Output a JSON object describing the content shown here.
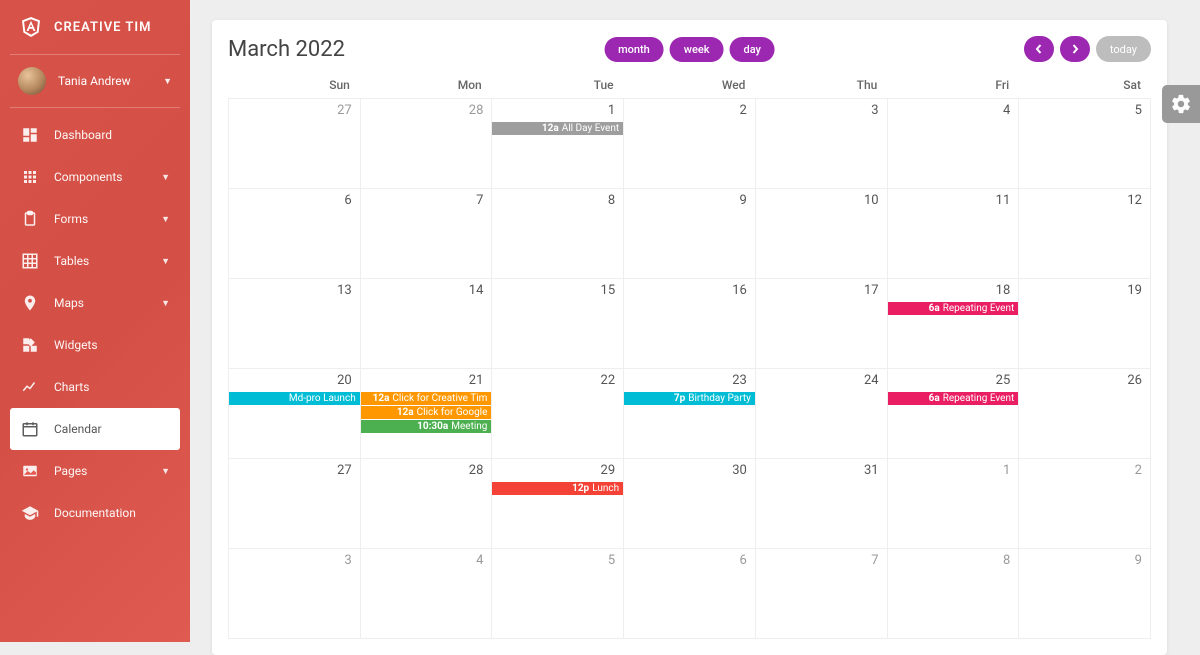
{
  "brand": {
    "title": "CREATIVE TIM"
  },
  "user": {
    "name": "Tania Andrew"
  },
  "sidebar": {
    "items": [
      {
        "label": "Dashboard",
        "icon": "dashboard",
        "caret": false
      },
      {
        "label": "Components",
        "icon": "apps",
        "caret": true
      },
      {
        "label": "Forms",
        "icon": "clipboard",
        "caret": true
      },
      {
        "label": "Tables",
        "icon": "grid",
        "caret": true
      },
      {
        "label": "Maps",
        "icon": "pin",
        "caret": true
      },
      {
        "label": "Widgets",
        "icon": "widgets",
        "caret": false
      },
      {
        "label": "Charts",
        "icon": "chart",
        "caret": false
      },
      {
        "label": "Calendar",
        "icon": "calendar",
        "caret": false,
        "active": true
      },
      {
        "label": "Pages",
        "icon": "image",
        "caret": true
      },
      {
        "label": "Documentation",
        "icon": "school",
        "caret": false
      }
    ]
  },
  "calendar": {
    "title": "March 2022",
    "views": {
      "month": "month",
      "week": "week",
      "day": "day"
    },
    "today": "today",
    "days": [
      "Sun",
      "Mon",
      "Tue",
      "Wed",
      "Thu",
      "Fri",
      "Sat"
    ],
    "cells": [
      {
        "n": "27",
        "in": false
      },
      {
        "n": "28",
        "in": false
      },
      {
        "n": "1",
        "in": true,
        "events": [
          {
            "t": "12a",
            "txt": "All Day Event",
            "c": "#9e9e9e"
          }
        ]
      },
      {
        "n": "2",
        "in": true
      },
      {
        "n": "3",
        "in": true
      },
      {
        "n": "4",
        "in": true
      },
      {
        "n": "5",
        "in": true
      },
      {
        "n": "6",
        "in": true
      },
      {
        "n": "7",
        "in": true
      },
      {
        "n": "8",
        "in": true
      },
      {
        "n": "9",
        "in": true
      },
      {
        "n": "10",
        "in": true
      },
      {
        "n": "11",
        "in": true
      },
      {
        "n": "12",
        "in": true
      },
      {
        "n": "13",
        "in": true
      },
      {
        "n": "14",
        "in": true
      },
      {
        "n": "15",
        "in": true
      },
      {
        "n": "16",
        "in": true
      },
      {
        "n": "17",
        "in": true
      },
      {
        "n": "18",
        "in": true,
        "events": [
          {
            "t": "6a",
            "txt": "Repeating Event",
            "c": "#e91e63"
          }
        ]
      },
      {
        "n": "19",
        "in": true
      },
      {
        "n": "20",
        "in": true,
        "events": [
          {
            "t": "",
            "txt": "Md-pro Launch",
            "c": "#00bcd4"
          }
        ]
      },
      {
        "n": "21",
        "in": true,
        "events": [
          {
            "t": "12a",
            "txt": "Click for Creative Tim",
            "c": "#ff9800"
          },
          {
            "t": "12a",
            "txt": "Click for Google",
            "c": "#ff9800"
          },
          {
            "t": "10:30a",
            "txt": "Meeting",
            "c": "#4caf50"
          }
        ]
      },
      {
        "n": "22",
        "in": true
      },
      {
        "n": "23",
        "in": true,
        "events": [
          {
            "t": "7p",
            "txt": "Birthday Party",
            "c": "#00bcd4"
          }
        ]
      },
      {
        "n": "24",
        "in": true
      },
      {
        "n": "25",
        "in": true,
        "events": [
          {
            "t": "6a",
            "txt": "Repeating Event",
            "c": "#e91e63"
          }
        ]
      },
      {
        "n": "26",
        "in": true
      },
      {
        "n": "27",
        "in": true
      },
      {
        "n": "28",
        "in": true
      },
      {
        "n": "29",
        "in": true,
        "events": [
          {
            "t": "12p",
            "txt": "Lunch",
            "c": "#f44336"
          }
        ]
      },
      {
        "n": "30",
        "in": true
      },
      {
        "n": "31",
        "in": true
      },
      {
        "n": "1",
        "in": false
      },
      {
        "n": "2",
        "in": false
      },
      {
        "n": "3",
        "in": false
      },
      {
        "n": "4",
        "in": false
      },
      {
        "n": "5",
        "in": false
      },
      {
        "n": "6",
        "in": false
      },
      {
        "n": "7",
        "in": false
      },
      {
        "n": "8",
        "in": false
      },
      {
        "n": "9",
        "in": false
      }
    ]
  },
  "colors": {
    "purple": "#9c27b0"
  }
}
